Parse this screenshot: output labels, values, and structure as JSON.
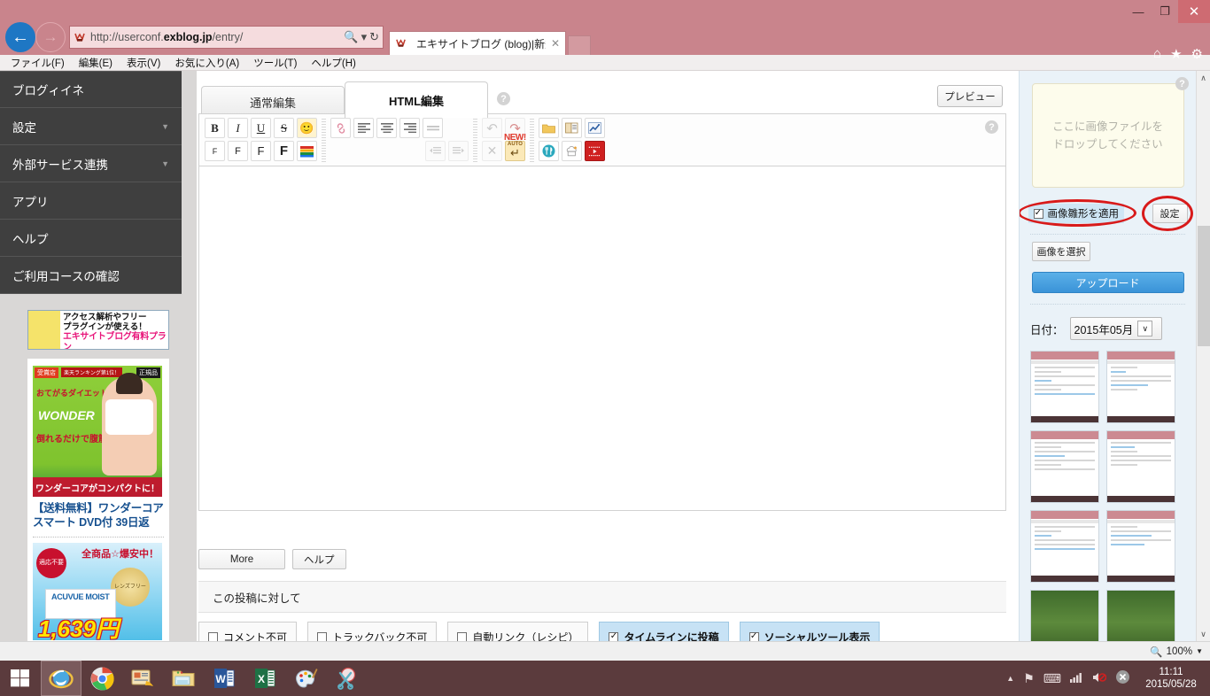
{
  "browser": {
    "window_controls": {
      "minimize": "—",
      "restore": "❐",
      "close": "✕"
    },
    "back_arrow": "←",
    "forward_arrow": "→",
    "url_prefix": "http://userconf.",
    "url_domain": "exblog.jp",
    "url_suffix": "/entry/",
    "search_icon": "🔍",
    "dropdown_icon": "▾",
    "refresh_icon": "↻",
    "tab_title": "エキサイトブログ (blog)|新規...",
    "tab_close": "✕",
    "home_icon": "⌂",
    "favorites_icon": "★",
    "tools_icon": "⚙",
    "menu": [
      {
        "label": "ファイル(F)"
      },
      {
        "label": "編集(E)"
      },
      {
        "label": "表示(V)"
      },
      {
        "label": "お気に入り(A)"
      },
      {
        "label": "ツール(T)"
      },
      {
        "label": "ヘルプ(H)"
      }
    ]
  },
  "sidebar": {
    "items": [
      {
        "label": "ブログィイネ",
        "caret": ""
      },
      {
        "label": "設定",
        "caret": "▼"
      },
      {
        "label": "外部サービス連携",
        "caret": "▼"
      },
      {
        "label": "アプリ",
        "caret": ""
      },
      {
        "label": "ヘルプ",
        "caret": ""
      },
      {
        "label": "ご利用コースの確認",
        "caret": ""
      }
    ],
    "promo_banner": {
      "line1": "アクセス解析やフリー",
      "line2": "プラグインが使える！",
      "line3": "エキサイトブログ有料プラン"
    },
    "ads": [
      {
        "badge_left": "受賞店",
        "badge_mid": "楽天ランキング第1位！",
        "badge_right": "正規品",
        "copy1": "おてがるダイエットに",
        "brand": "WONDER",
        "copy2": "倒れるだけで腹筋!!",
        "band": "ワンダーコアがコンパクトに！",
        "title": "【送料無料】ワンダーコア スマート DVD付 39日返"
      },
      {
        "headline": "全商品☆爆安中！",
        "seal": "適応不要",
        "seal2": "レンズフリー",
        "product": "ACUVUE MOIST",
        "price": "1,639円"
      }
    ]
  },
  "editor": {
    "tabs": [
      {
        "label": "通常編集",
        "active": false
      },
      {
        "label": "HTML編集",
        "active": true
      }
    ],
    "help_icon": "?",
    "preview_label": "プレビュー",
    "toolbar_row1": [
      {
        "name": "bold-button",
        "glyph": "B"
      },
      {
        "name": "italic-button",
        "glyph": "I"
      },
      {
        "name": "underline-button",
        "glyph": "U"
      },
      {
        "name": "strikethrough-button",
        "glyph": "S"
      },
      {
        "name": "emoji-button",
        "glyph": "🙂"
      }
    ],
    "toolbar_row2": [
      {
        "name": "font-size-small-button",
        "glyph": "F"
      },
      {
        "name": "font-size-medium-button",
        "glyph": "F"
      },
      {
        "name": "font-size-large-button",
        "glyph": "F"
      },
      {
        "name": "font-size-xlarge-button",
        "glyph": "F"
      },
      {
        "name": "font-color-button",
        "glyph": "▓"
      }
    ],
    "toolbar_align1": [
      {
        "name": "link-button",
        "glyph": "🔗"
      },
      {
        "name": "align-left-button",
        "glyph": "≡"
      },
      {
        "name": "align-center-button",
        "glyph": "≡"
      },
      {
        "name": "align-right-button",
        "glyph": "≡"
      },
      {
        "name": "align-justify-button",
        "glyph": "≡"
      }
    ],
    "toolbar_align2": [
      {
        "name": "outdent-button",
        "glyph": "≡"
      },
      {
        "name": "indent-button",
        "glyph": "≡"
      }
    ],
    "toolbar_history1": [
      {
        "name": "undo-button",
        "glyph": "↶"
      },
      {
        "name": "redo-button",
        "glyph": "↷"
      }
    ],
    "toolbar_history2": [
      {
        "name": "clear-button",
        "glyph": "✕"
      },
      {
        "name": "auto-return-button",
        "glyph": "↵"
      }
    ],
    "new_badge": "NEW!",
    "auto_badge": "AUTO",
    "toolbar_media1": [
      {
        "name": "folder-button",
        "glyph": "📁"
      },
      {
        "name": "book-button",
        "glyph": "📖"
      },
      {
        "name": "chart-button",
        "glyph": "📈"
      }
    ],
    "toolbar_media2": [
      {
        "name": "restaurant-button",
        "glyph": "🍴"
      },
      {
        "name": "recipe-button",
        "glyph": "👩‍🍳"
      },
      {
        "name": "video-button",
        "glyph": "▶"
      }
    ],
    "content": "",
    "more_label": "More",
    "help_label": "ヘルプ",
    "section_title": "この投稿に対して",
    "post_options": [
      {
        "label": "コメント不可",
        "checked": false
      },
      {
        "label": "トラックバック不可",
        "checked": false
      },
      {
        "label": "自動リンク（レシピ）",
        "checked": false
      },
      {
        "label": "タイムラインに投稿",
        "checked": true
      },
      {
        "label": "ソーシャルツール表示",
        "checked": true
      }
    ],
    "checked_glyph": "✓",
    "unchecked_glyph": ""
  },
  "image_panel": {
    "help_icon": "?",
    "dropzone_line1": "ここに画像ファイルを",
    "dropzone_line2": "ドロップしてください",
    "apply_template_label": "画像雛形を適用",
    "apply_template_checked": true,
    "settings_label": "設定",
    "select_image_label": "画像を選択",
    "upload_label": "アップロード",
    "date_label": "日付：",
    "date_value": "2015年05月",
    "date_caret": "∨",
    "highlight_color": "#d81a1a",
    "accent_color": "#3a93d8",
    "thumbnails": [
      {
        "kind": "screenshot"
      },
      {
        "kind": "screenshot"
      },
      {
        "kind": "screenshot"
      },
      {
        "kind": "screenshot"
      },
      {
        "kind": "screenshot"
      },
      {
        "kind": "screenshot"
      },
      {
        "kind": "photo"
      },
      {
        "kind": "photo"
      }
    ]
  },
  "page_scroll": {
    "up": "∧",
    "down": "∨"
  },
  "status": {
    "zoom_icon": "🔍",
    "zoom_level": "100%",
    "zoom_caret": "▼"
  },
  "taskbar": {
    "start_icon": "windows-logo",
    "apps": [
      {
        "name": "internet-explorer",
        "active": true
      },
      {
        "name": "google-chrome",
        "active": false
      },
      {
        "name": "windows-live-mail",
        "active": false
      },
      {
        "name": "file-explorer",
        "active": false
      },
      {
        "name": "microsoft-word",
        "active": false
      },
      {
        "name": "microsoft-excel",
        "active": false
      },
      {
        "name": "paint",
        "active": false
      },
      {
        "name": "snipping-tool",
        "active": false
      }
    ],
    "tray": {
      "expand": "▲",
      "flag_icon": "⚑",
      "ime_icon": "⌨",
      "network_icon": "◢",
      "volume_icon": "🔈",
      "alert_icon": "✕",
      "time": "11:11",
      "date": "2015/05/28"
    }
  }
}
